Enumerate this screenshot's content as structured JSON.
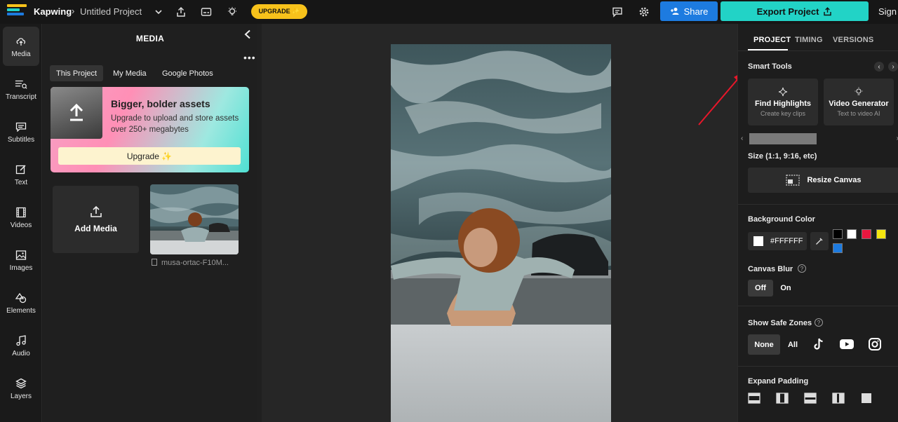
{
  "topbar": {
    "brand": "Kapwing",
    "breadcrumb_sep": "›",
    "project_name": "Untitled Project",
    "upgrade_label": "UPGRADE ✨",
    "share_label": "Share",
    "export_label": "Export Project",
    "signin_label": "Sign In",
    "logo_colors": [
      "#f7c21b",
      "#22d3c6",
      "#1d7be0"
    ]
  },
  "leftnav": {
    "items": [
      {
        "label": "Media",
        "icon": "upload-cloud-icon"
      },
      {
        "label": "Transcript",
        "icon": "transcript-icon"
      },
      {
        "label": "Subtitles",
        "icon": "subtitles-icon"
      },
      {
        "label": "Text",
        "icon": "text-edit-icon"
      },
      {
        "label": "Videos",
        "icon": "film-icon"
      },
      {
        "label": "Images",
        "icon": "image-icon"
      },
      {
        "label": "Elements",
        "icon": "shapes-icon"
      },
      {
        "label": "Audio",
        "icon": "music-note-icon"
      },
      {
        "label": "Layers",
        "icon": "layers-icon"
      }
    ]
  },
  "media": {
    "title": "MEDIA",
    "tabs": [
      "This Project",
      "My Media",
      "Google Photos"
    ],
    "promo": {
      "title": "Bigger, bolder assets",
      "text": "Upgrade to upload and store assets over 250+ megabytes",
      "button": "Upgrade ✨"
    },
    "add_media": "Add Media",
    "file_name": "musa-ortac-F10M..."
  },
  "right_panel": {
    "tabs": [
      "PROJECT",
      "TIMING",
      "VERSIONS"
    ],
    "smart_tools_label": "Smart Tools",
    "tools": [
      {
        "title": "Find Highlights",
        "subtitle": "Create key clips"
      },
      {
        "title": "Video Generator",
        "subtitle": "Text to video AI"
      }
    ],
    "size_label": "Size (1:1, 9:16, etc)",
    "resize_button": "Resize Canvas",
    "bg_color_label": "Background Color",
    "bg_color_value": "#FFFFFF",
    "swatches": [
      "#000000",
      "#ffffff",
      "#e8173f",
      "#f5e60f",
      "#1d7be0"
    ],
    "canvas_blur_label": "Canvas Blur",
    "blur_options": [
      "Off",
      "On"
    ],
    "safe_zones_label": "Show Safe Zones",
    "safe_zone_options": [
      "None",
      "All"
    ],
    "safe_zone_icons": [
      "tiktok-icon",
      "youtube-icon",
      "instagram-icon"
    ],
    "expand_padding_label": "Expand Padding"
  }
}
